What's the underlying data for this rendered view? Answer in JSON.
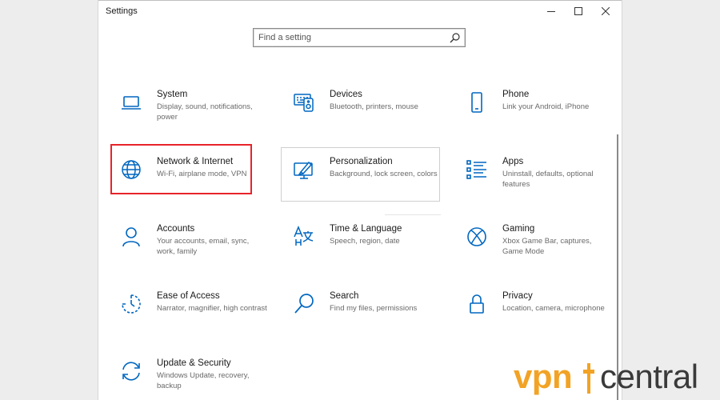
{
  "window": {
    "title": "Settings"
  },
  "search": {
    "placeholder": "Find a setting"
  },
  "colors": {
    "accent": "#0067c0",
    "highlight": "#e8232a",
    "watermark_orange": "#f2a325"
  },
  "tiles": [
    {
      "title": "System",
      "desc": "Display, sound, notifications, power",
      "icon": "laptop-icon"
    },
    {
      "title": "Devices",
      "desc": "Bluetooth, printers, mouse",
      "icon": "devices-icon"
    },
    {
      "title": "Phone",
      "desc": "Link your Android, iPhone",
      "icon": "phone-icon"
    },
    {
      "title": "Network & Internet",
      "desc": "Wi-Fi, airplane mode, VPN",
      "icon": "globe-icon"
    },
    {
      "title": "Personalization",
      "desc": "Background, lock screen, colors",
      "icon": "paint-icon"
    },
    {
      "title": "Apps",
      "desc": "Uninstall, defaults, optional features",
      "icon": "apps-list-icon"
    },
    {
      "title": "Accounts",
      "desc": "Your accounts, email, sync, work, family",
      "icon": "person-icon"
    },
    {
      "title": "Time & Language",
      "desc": "Speech, region, date",
      "icon": "time-language-icon"
    },
    {
      "title": "Gaming",
      "desc": "Xbox Game Bar, captures, Game Mode",
      "icon": "xbox-icon"
    },
    {
      "title": "Ease of Access",
      "desc": "Narrator, magnifier, high contrast",
      "icon": "ease-of-access-icon"
    },
    {
      "title": "Search",
      "desc": "Find my files, permissions",
      "icon": "search-magnifier-icon"
    },
    {
      "title": "Privacy",
      "desc": "Location, camera, microphone",
      "icon": "lock-icon"
    },
    {
      "title": "Update & Security",
      "desc": "Windows Update, recovery, backup",
      "icon": "update-icon"
    }
  ],
  "watermark": {
    "part1": "vpn",
    "part2": "central"
  }
}
